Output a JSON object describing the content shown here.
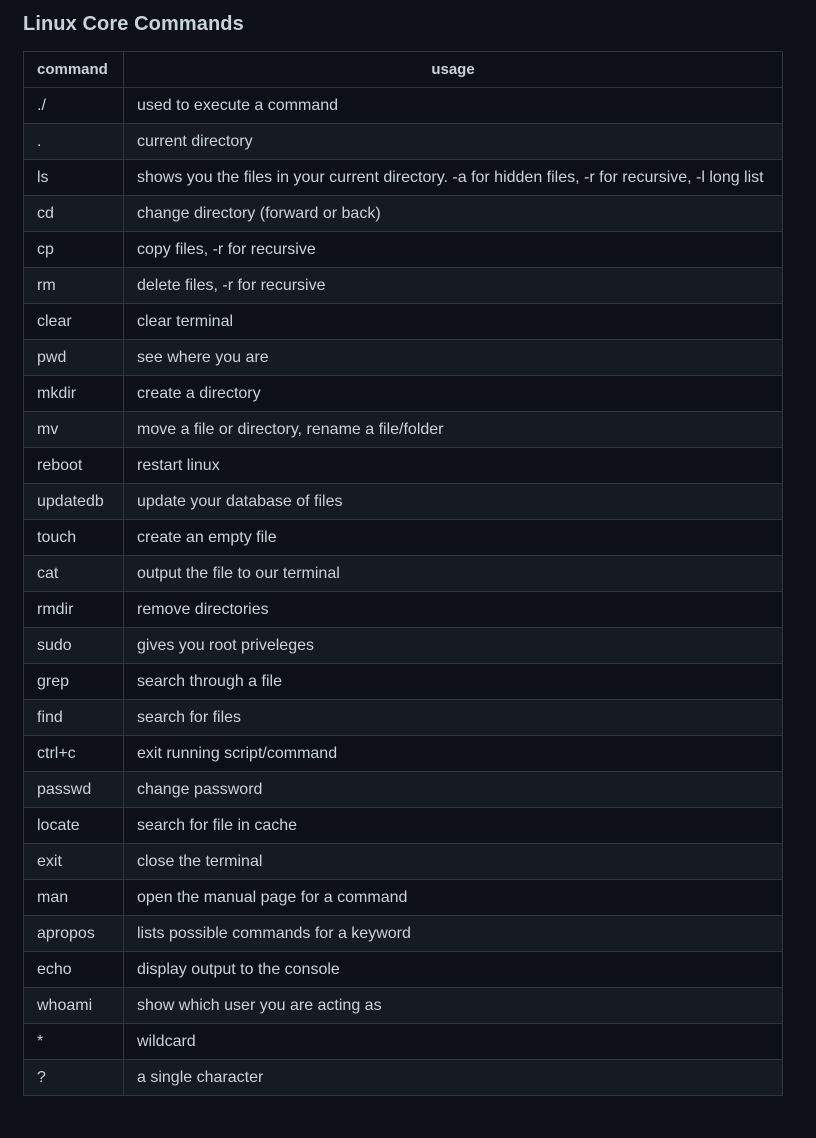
{
  "heading": "Linux Core Commands",
  "table": {
    "headers": {
      "command": "command",
      "usage": "usage"
    },
    "rows": [
      {
        "command": "./",
        "usage": "used to execute a command"
      },
      {
        "command": ".",
        "usage": "current directory"
      },
      {
        "command": "ls",
        "usage": "shows you the files in your current directory. -a for hidden files, -r for recursive, -l long list"
      },
      {
        "command": "cd",
        "usage": "change directory (forward or back)"
      },
      {
        "command": "cp",
        "usage": "copy files, -r for recursive"
      },
      {
        "command": "rm",
        "usage": "delete files, -r for recursive"
      },
      {
        "command": "clear",
        "usage": "clear terminal"
      },
      {
        "command": "pwd",
        "usage": "see where you are"
      },
      {
        "command": "mkdir",
        "usage": "create a directory"
      },
      {
        "command": "mv",
        "usage": "move a file or directory, rename a file/folder"
      },
      {
        "command": "reboot",
        "usage": "restart linux"
      },
      {
        "command": "updatedb",
        "usage": "update your database of files"
      },
      {
        "command": "touch",
        "usage": "create an empty file"
      },
      {
        "command": "cat",
        "usage": "output the file to our terminal"
      },
      {
        "command": "rmdir",
        "usage": "remove directories"
      },
      {
        "command": "sudo",
        "usage": "gives you root priveleges"
      },
      {
        "command": "grep",
        "usage": "search through a file"
      },
      {
        "command": "find",
        "usage": "search for files"
      },
      {
        "command": "ctrl+c",
        "usage": "exit running script/command"
      },
      {
        "command": "passwd",
        "usage": "change password"
      },
      {
        "command": "locate",
        "usage": "search for file in cache"
      },
      {
        "command": "exit",
        "usage": "close the terminal"
      },
      {
        "command": "man",
        "usage": "open the manual page for a command"
      },
      {
        "command": "apropos",
        "usage": "lists possible commands for a keyword"
      },
      {
        "command": "echo",
        "usage": "display output to the console"
      },
      {
        "command": "whoami",
        "usage": "show which user you are acting as"
      },
      {
        "command": "*",
        "usage": "wildcard"
      },
      {
        "command": "?",
        "usage": "a single character"
      }
    ]
  },
  "colors": {
    "background": "#0d1117",
    "row_alt": "#161b22",
    "border": "#30363d",
    "text": "#c9d1d9"
  }
}
